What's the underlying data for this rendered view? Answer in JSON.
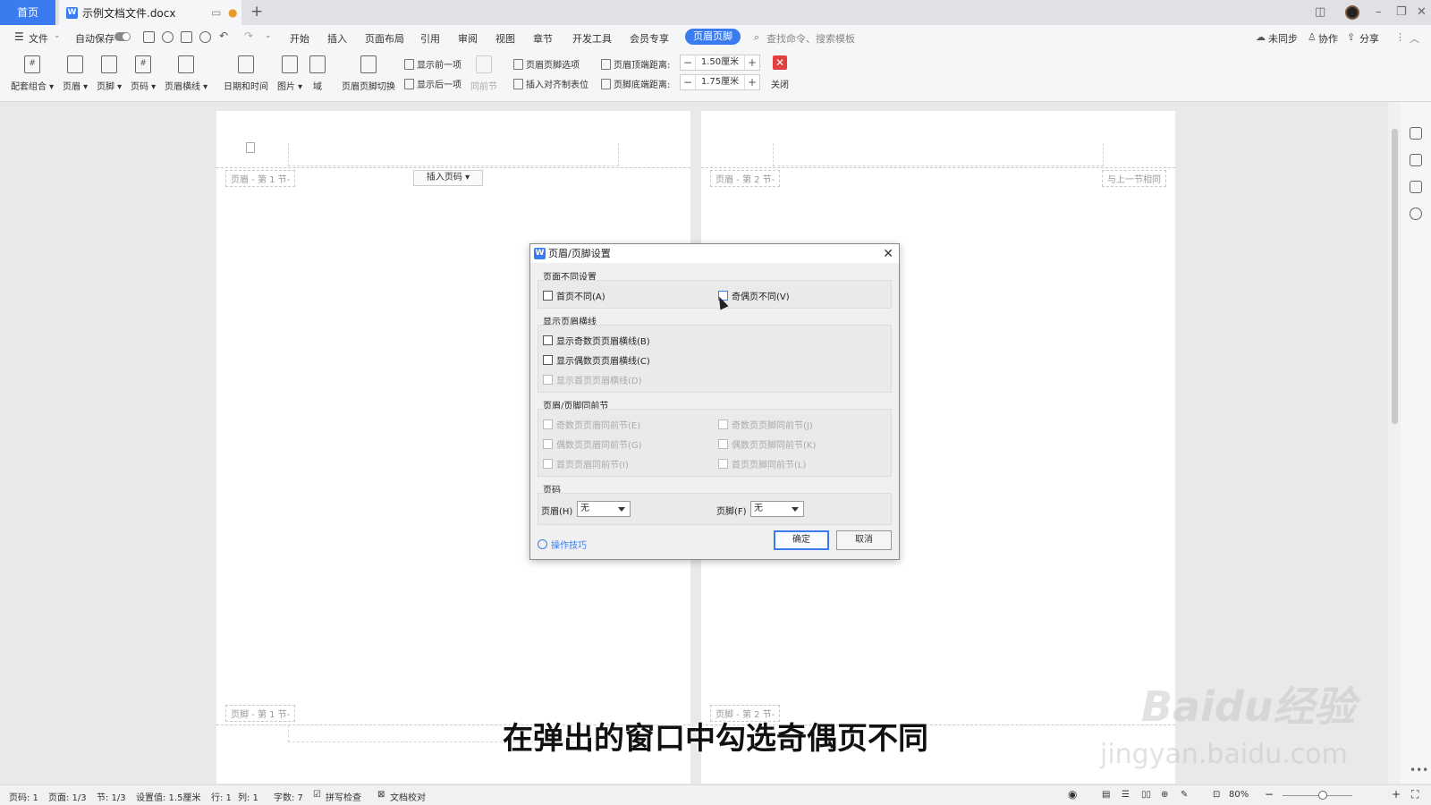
{
  "tabs": {
    "home": "首页",
    "doc_title": "示例文档文件.docx"
  },
  "menu": {
    "file": "文件",
    "autosave": "自动保存",
    "items": [
      "开始",
      "插入",
      "页面布局",
      "引用",
      "审阅",
      "视图",
      "章节",
      "开发工具",
      "会员专享"
    ],
    "active": "页眉页脚",
    "search": "查找命令、搜索模板",
    "unsync": "未同步",
    "collab": "协作",
    "share": "分享"
  },
  "ribbon": {
    "combo": "配套组合",
    "header": "页眉",
    "footer": "页脚",
    "page_number": "页码",
    "header_line": "页眉横线",
    "datetime": "日期和时间",
    "picture": "图片",
    "field": "域",
    "switch": "页眉页脚切换",
    "show_prev": "显示前一项",
    "show_next": "显示后一项",
    "same_prev": "同前节",
    "hf_options": "页眉页脚选项",
    "insert_align_tab": "插入对齐制表位",
    "header_top_label": "页眉顶端距离:",
    "header_top_value": "1.50厘米",
    "footer_bottom_label": "页脚底端距离:",
    "footer_bottom_value": "1.75厘米",
    "close": "关闭"
  },
  "page1": {
    "header_label": "页眉 - 第 1 节-",
    "footer_label": "页脚 - 第 1 节-",
    "insert_page_num": "插入页码"
  },
  "page2": {
    "header_label": "页眉 - 第 2 节-",
    "footer_label": "页脚 - 第 2 节-",
    "same_as_prev": "与上一节相同"
  },
  "dialog": {
    "title": "页眉/页脚设置",
    "group_diff": "页面不同设置",
    "first_diff": "首页不同(A)",
    "odd_even_diff": "奇偶页不同(V)",
    "group_line": "显示页眉横线",
    "odd_line": "显示奇数页页眉横线(B)",
    "even_line": "显示偶数页页眉横线(C)",
    "first_line": "显示首页页眉横线(D)",
    "group_same": "页眉/页脚同前节",
    "odd_header_same": "奇数页页眉同前节(E)",
    "even_header_same": "偶数页页眉同前节(G)",
    "first_header_same": "首页页眉同前节(I)",
    "odd_footer_same": "奇数页页脚同前节(J)",
    "even_footer_same": "偶数页页脚同前节(K)",
    "first_footer_same": "首页页脚同前节(L)",
    "group_pn": "页码",
    "header_pn_label": "页眉(H)",
    "header_pn_value": "无",
    "footer_pn_label": "页脚(F)",
    "footer_pn_value": "无",
    "tips": "操作技巧",
    "ok": "确定",
    "cancel": "取消"
  },
  "status": {
    "page_code": "页码: 1",
    "pages": "页面: 1/3",
    "section": "节: 1/3",
    "setting": "设置值: 1.5厘米",
    "row": "行: 1",
    "col": "列: 1",
    "words": "字数: 7",
    "spell": "拼写检查",
    "proof": "文档校对",
    "zoom": "80%"
  },
  "subtitle": "在弹出的窗口中勾选奇偶页不同",
  "watermark": {
    "main": "Baidu经验",
    "sub": "jingyan.baidu.com"
  }
}
